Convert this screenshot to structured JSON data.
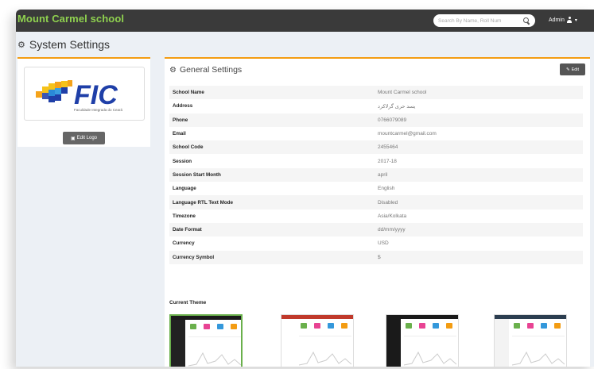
{
  "app": {
    "title": "Mount Carmel school"
  },
  "topbar": {
    "search_placeholder": "Search By Name, Roll Num",
    "user_label": "Admin",
    "caret": "▾"
  },
  "page": {
    "title": "System Settings"
  },
  "logo": {
    "brand": "FIC",
    "subtitle": "Faculdade Integrada do Ceará",
    "edit_button": "Edit Logo"
  },
  "general": {
    "title": "General Settings",
    "edit_button": "Edit",
    "rows": [
      {
        "label": "School Name",
        "value": "Mount Carmel school"
      },
      {
        "label": "Address",
        "value": "یسد حری گرلاکرد"
      },
      {
        "label": "Phone",
        "value": "0766079089"
      },
      {
        "label": "Email",
        "value": "mountcarmel@gmail.com"
      },
      {
        "label": "School Code",
        "value": "2455464"
      },
      {
        "label": "Session",
        "value": "2017-18"
      },
      {
        "label": "Session Start Month",
        "value": "april"
      },
      {
        "label": "Language",
        "value": "English"
      },
      {
        "label": "Language RTL Text Mode",
        "value": "Disabled"
      },
      {
        "label": "Timezone",
        "value": "Asia/Kolkata"
      },
      {
        "label": "Date Format",
        "value": "dd/mm/yyyy"
      },
      {
        "label": "Currency",
        "value": "USD"
      },
      {
        "label": "Currency Symbol",
        "value": "$"
      }
    ]
  },
  "theme": {
    "label": "Current Theme",
    "options": [
      {
        "name": "default",
        "selected": true,
        "top": "#1a1a1a",
        "side": "#222222"
      },
      {
        "name": "red",
        "selected": false,
        "top": "#c0392b",
        "side": "#ffffff"
      },
      {
        "name": "dark",
        "selected": false,
        "top": "#1a1a1a",
        "side": "#1a1a1a"
      },
      {
        "name": "light",
        "selected": false,
        "top": "#2c3e50",
        "side": "#f3f3f3"
      }
    ]
  },
  "colors": {
    "accent": "#f39c12",
    "brand_green": "#8fd14f",
    "topbar": "#3a3a3a"
  }
}
